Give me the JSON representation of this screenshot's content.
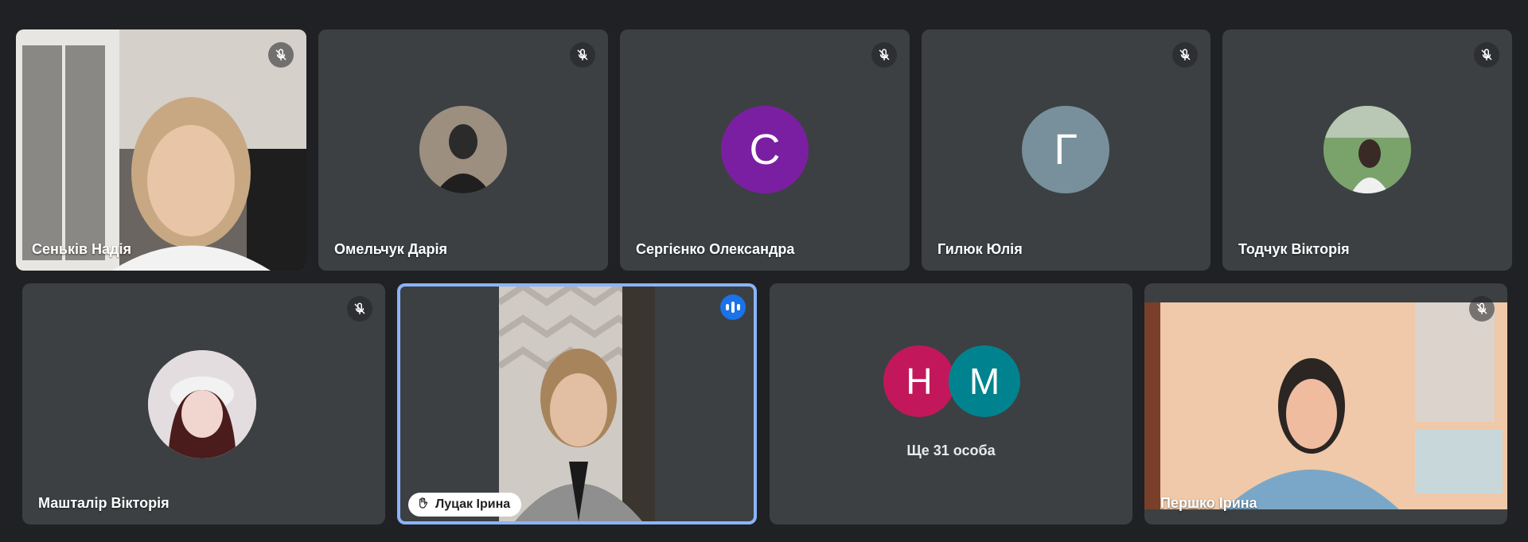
{
  "participants": [
    {
      "name": "Сеньків Надія",
      "muted": true,
      "type": "video"
    },
    {
      "name": "Омельчук Дарія",
      "muted": true,
      "type": "photo"
    },
    {
      "name": "Сергієнко Олександра",
      "muted": true,
      "type": "initial",
      "initial": "С",
      "color": "#7b1fa2"
    },
    {
      "name": "Гилюк Юлія",
      "muted": true,
      "type": "initial",
      "initial": "Г",
      "color": "#78909c"
    },
    {
      "name": "Тодчук Вікторія",
      "muted": true,
      "type": "photo"
    },
    {
      "name": "Машталір Вікторія",
      "muted": true,
      "type": "photo"
    },
    {
      "name": "Луцак Ірина",
      "muted": false,
      "speaking": true,
      "hand_raised": true,
      "type": "video"
    },
    {
      "name": "Першко Ірина",
      "muted": true,
      "type": "video"
    }
  ],
  "others": {
    "label": "Ще 31 особа",
    "avatars": [
      {
        "initial": "Н",
        "color": "#c2185b"
      },
      {
        "initial": "М",
        "color": "#00838f"
      }
    ]
  },
  "colors": {
    "background": "#202124",
    "tile": "#3c4043",
    "active_border": "#8ab4f8",
    "speaking": "#1a73e8"
  }
}
